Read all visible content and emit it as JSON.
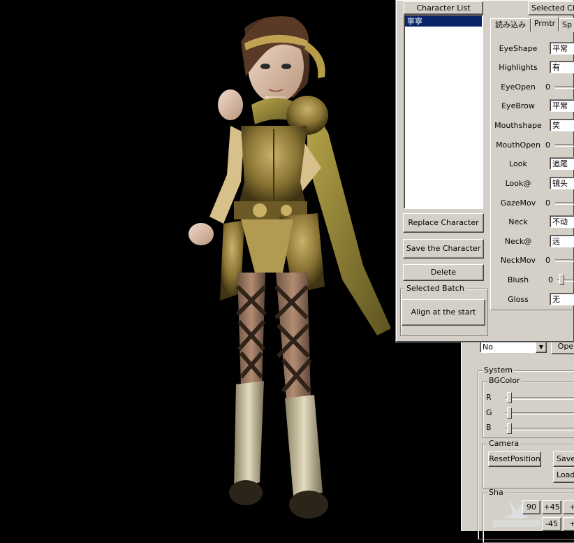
{
  "character_list_panel": {
    "header": "Character List",
    "items": [
      "寧寧"
    ],
    "selected_index": 0,
    "buttons": {
      "replace": "Replace Character",
      "save": "Save the Character",
      "delete": "Delete"
    },
    "selected_batch": {
      "title": "Selected Batch",
      "align_button": "Align at the start"
    }
  },
  "selected_character_panel": {
    "header": "Selected Cha",
    "tabs": [
      "読み込み",
      "Prmtr",
      "Sp"
    ],
    "active_tab": 1,
    "params": [
      {
        "label": "EyeShape",
        "kind": "combo",
        "value": "平常"
      },
      {
        "label": "Highlights",
        "kind": "combo",
        "value": "有"
      },
      {
        "label": "EyeOpen",
        "kind": "slider",
        "value": "0"
      },
      {
        "label": "EyeBrow",
        "kind": "combo",
        "value": "平常"
      },
      {
        "label": "Mouthshape",
        "kind": "combo",
        "value": "笑"
      },
      {
        "label": "MouthOpen",
        "kind": "slider",
        "value": "0"
      },
      {
        "label": "Look",
        "kind": "combo",
        "value": "追尾"
      },
      {
        "label": "Look@",
        "kind": "combo",
        "value": "镜头"
      },
      {
        "label": "GazeMov",
        "kind": "slider",
        "value": "0"
      },
      {
        "label": "Neck",
        "kind": "combo",
        "value": "不动"
      },
      {
        "label": "Neck@",
        "kind": "combo",
        "value": "远"
      },
      {
        "label": "NeckMov",
        "kind": "slider",
        "value": "0"
      },
      {
        "label": "Blush",
        "kind": "slider",
        "value": "0"
      },
      {
        "label": "Gloss",
        "kind": "combo",
        "value": "无"
      }
    ]
  },
  "back_panel": {
    "dropdown_value": "No",
    "open_button": "Ope",
    "system": {
      "title": "System",
      "bgcolor": {
        "title": "BGColor",
        "channels": [
          "R",
          "G",
          "B"
        ]
      },
      "camera": {
        "title": "Camera",
        "reset_button": "ResetPosition",
        "save_button": "Save",
        "load_button": "Load"
      },
      "shadow": {
        "title": "Sha",
        "buttons_row1": [
          "90",
          "+45",
          "+"
        ],
        "buttons_row2": [
          "-45",
          "+"
        ]
      }
    }
  },
  "colors": {
    "dialog_bg": "#d4d0c8",
    "selection": "#0a246a",
    "viewport_bg": "#000000"
  }
}
